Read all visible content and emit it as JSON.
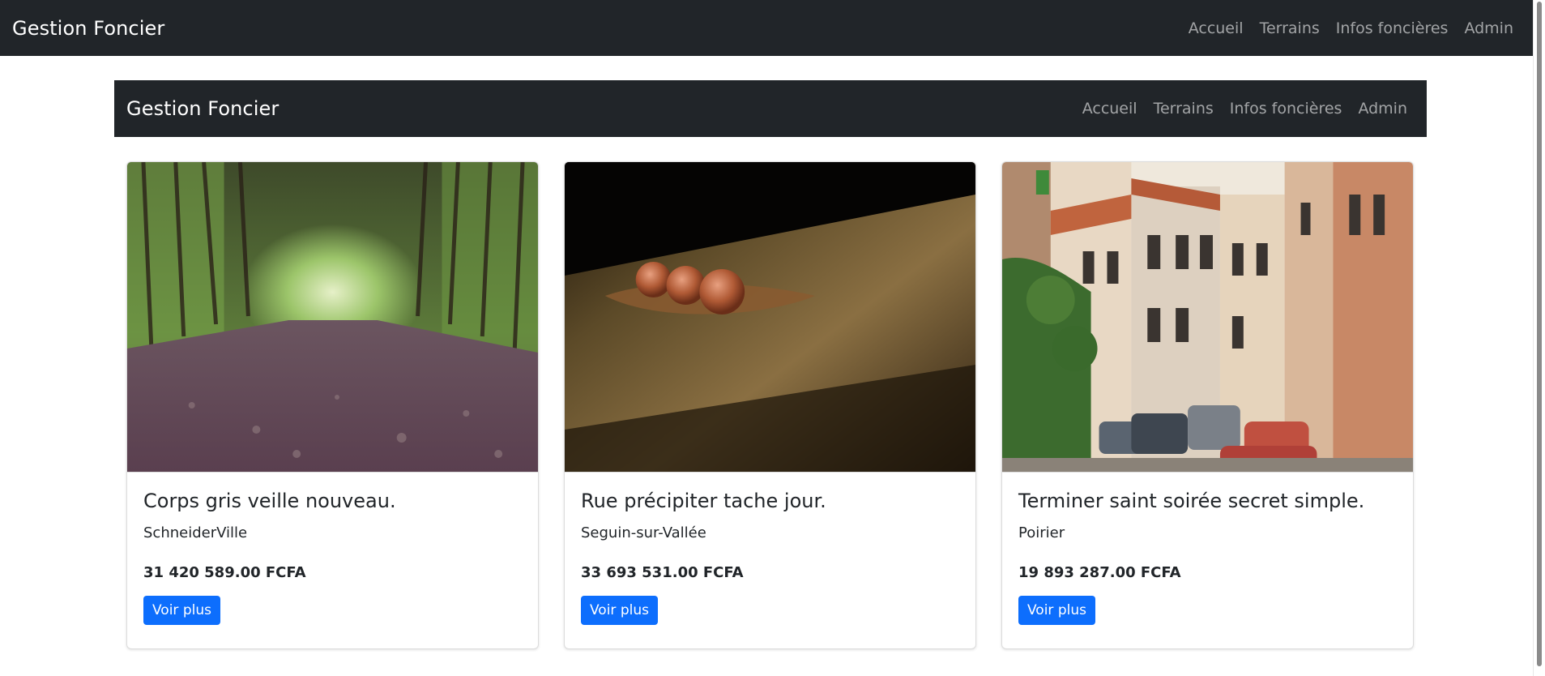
{
  "topnav": {
    "brand": "Gestion Foncier",
    "links": [
      "Accueil",
      "Terrains",
      "Infos foncières",
      "Admin"
    ]
  },
  "innernav": {
    "brand": "Gestion Foncier",
    "links": [
      "Accueil",
      "Terrains",
      "Infos foncières",
      "Admin"
    ]
  },
  "cards": [
    {
      "title": "Corps gris veille nouveau.",
      "city": "SchneiderVille",
      "price": "31 420 589.00 FCFA",
      "button": "Voir plus",
      "image_subject": "forest-path-photo"
    },
    {
      "title": "Rue précipiter tache jour.",
      "city": "Seguin-sur-Vallée",
      "price": "33 693 531.00 FCFA",
      "button": "Voir plus",
      "image_subject": "berries-on-leaf-photo"
    },
    {
      "title": "Terminer saint soirée secret simple.",
      "city": "Poirier",
      "price": "19 893 287.00 FCFA",
      "button": "Voir plus",
      "image_subject": "old-town-street-photo"
    }
  ],
  "colors": {
    "navbar": "#212529",
    "primary": "#0d6efd",
    "navlink": "rgba(255,255,255,0.58)"
  }
}
